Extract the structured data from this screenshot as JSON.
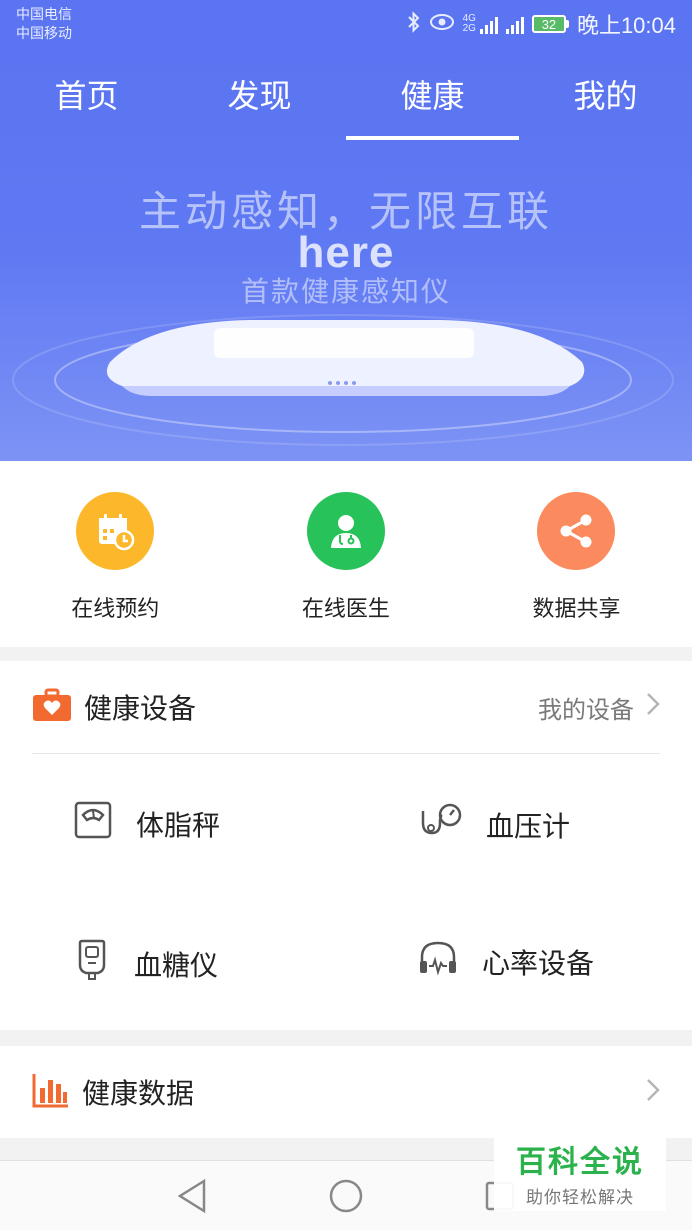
{
  "status_bar": {
    "carrier_1": "中国电信",
    "carrier_2": "中国移动",
    "network_1": "4G",
    "network_2": "2G",
    "battery": "32",
    "time": "晚上10:04"
  },
  "tabs": [
    {
      "label": "首页",
      "active": false
    },
    {
      "label": "发现",
      "active": false
    },
    {
      "label": "健康",
      "active": true
    },
    {
      "label": "我的",
      "active": false
    }
  ],
  "banner": {
    "title": "主动感知，无限互联",
    "brand": "here",
    "subtitle": "首款健康感知仪"
  },
  "quick_actions": [
    {
      "label": "在线预约",
      "icon": "calendar-clock-icon",
      "color": "#fcb82a"
    },
    {
      "label": "在线医生",
      "icon": "doctor-icon",
      "color": "#27c25a"
    },
    {
      "label": "数据共享",
      "icon": "share-icon",
      "color": "#fb8a5e"
    }
  ],
  "health_devices": {
    "title": "健康设备",
    "link": "我的设备",
    "items": [
      {
        "label": "体脂秤",
        "icon": "scale-icon"
      },
      {
        "label": "血压计",
        "icon": "stethoscope-icon"
      },
      {
        "label": "血糖仪",
        "icon": "glucose-meter-icon"
      },
      {
        "label": "心率设备",
        "icon": "heart-rate-headphones-icon"
      }
    ]
  },
  "health_data": {
    "title": "健康数据"
  },
  "watermark": {
    "title": "百科全说",
    "subtitle": "助你轻松解决"
  },
  "colors": {
    "header_blue": "#5a74f2",
    "accent_orange": "#f26a30"
  }
}
